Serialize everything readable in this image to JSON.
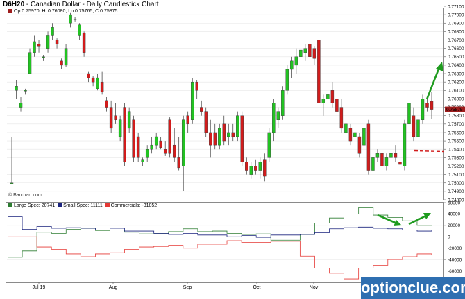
{
  "title": {
    "symbol": "D6H20",
    "text": "Canadian Dollar - Daily Candlestick Chart"
  },
  "ohlc_legend": "Op:0.75970, Hi:0.76080, Lo:0.75765, C:0.75875",
  "credit": "© Barchart.com",
  "watermark": "optionclue.com",
  "colors": {
    "up": "#22c322",
    "down": "#d11c1c",
    "large_spec": "#2e7d32",
    "small_spec": "#1a237e",
    "commercials": "#e53935",
    "last_price_bg": "#9e1d1d",
    "arrow": "#1f9b1f",
    "support": "#d11c1c"
  },
  "chart_data": [
    {
      "type": "candlestick",
      "title": "D6H20 - Canadian Dollar - Daily Candlestick Chart",
      "ylim": [
        0.748,
        0.771
      ],
      "yticks": [
        "0.77100",
        "0.77000",
        "0.76900",
        "0.76800",
        "0.76700",
        "0.76600",
        "0.76500",
        "0.76400",
        "0.76300",
        "0.76200",
        "0.76100",
        "0.76000",
        "0.75900",
        "0.75800",
        "0.75700",
        "0.75600",
        "0.75500",
        "0.75400",
        "0.75300",
        "0.75200",
        "0.75100",
        "0.75000",
        "0.74900",
        "0.74800"
      ],
      "last_price": "0.75875",
      "x_labels": [
        "Jul 19",
        "Aug",
        "Sep",
        "Oct",
        "Nov"
      ],
      "candles": [
        [
          0.75,
          0.7555,
          0.75,
          0.75
        ],
        [
          0.761,
          0.7622,
          0.76,
          0.7615
        ],
        [
          0.759,
          0.7602,
          0.7585,
          0.7595
        ],
        [
          0.761,
          0.7612,
          0.7605,
          0.761
        ],
        [
          0.763,
          0.766,
          0.763,
          0.7655
        ],
        [
          0.7655,
          0.7675,
          0.765,
          0.7668
        ],
        [
          0.7665,
          0.767,
          0.7655,
          0.7662
        ],
        [
          0.765,
          0.7652,
          0.7645,
          0.765
        ],
        [
          0.766,
          0.768,
          0.7655,
          0.7675
        ],
        [
          0.7675,
          0.769,
          0.767,
          0.7685
        ],
        [
          0.767,
          0.7672,
          0.766,
          0.7665
        ],
        [
          0.7645,
          0.7648,
          0.7635,
          0.764
        ],
        [
          0.764,
          0.7665,
          0.7638,
          0.766
        ],
        [
          0.769,
          0.7702,
          0.7685,
          0.77
        ],
        [
          0.7695,
          0.7697,
          0.7692,
          0.7695
        ],
        [
          0.7675,
          0.769,
          0.767,
          0.7688
        ],
        [
          0.7678,
          0.768,
          0.765,
          0.7655
        ],
        [
          0.763,
          0.7632,
          0.762,
          0.7625
        ],
        [
          0.7625,
          0.7627,
          0.7615,
          0.762
        ],
        [
          0.7612,
          0.763,
          0.761,
          0.7625
        ],
        [
          0.762,
          0.7632,
          0.7605,
          0.7608
        ],
        [
          0.7598,
          0.7602,
          0.7585,
          0.759
        ],
        [
          0.759,
          0.7598,
          0.756,
          0.7565
        ],
        [
          0.758,
          0.7595,
          0.757,
          0.7575
        ],
        [
          0.7555,
          0.758,
          0.755,
          0.7575
        ],
        [
          0.759,
          0.7595,
          0.752,
          0.7525
        ],
        [
          0.7565,
          0.759,
          0.756,
          0.7585
        ],
        [
          0.7575,
          0.758,
          0.7525,
          0.753
        ],
        [
          0.7555,
          0.756,
          0.7525,
          0.753
        ],
        [
          0.7525,
          0.753,
          0.752,
          0.7528
        ],
        [
          0.753,
          0.7545,
          0.7525,
          0.754
        ],
        [
          0.754,
          0.7555,
          0.7535,
          0.7545
        ],
        [
          0.7545,
          0.756,
          0.754,
          0.7555
        ],
        [
          0.755,
          0.7555,
          0.754,
          0.7542
        ],
        [
          0.754,
          0.755,
          0.7532,
          0.7535
        ],
        [
          0.7575,
          0.7578,
          0.753,
          0.7535
        ],
        [
          0.7545,
          0.7565,
          0.7525,
          0.753
        ],
        [
          0.753,
          0.7555,
          0.7515,
          0.7518
        ],
        [
          0.752,
          0.758,
          0.749,
          0.7575
        ],
        [
          0.758,
          0.7585,
          0.756,
          0.757
        ],
        [
          0.7575,
          0.7625,
          0.757,
          0.762
        ],
        [
          0.762,
          0.7622,
          0.76,
          0.761
        ],
        [
          0.759,
          0.7598,
          0.758,
          0.7585
        ],
        [
          0.7585,
          0.759,
          0.7555,
          0.756
        ],
        [
          0.756,
          0.7575,
          0.753,
          0.7545
        ],
        [
          0.756,
          0.757,
          0.754,
          0.7545
        ],
        [
          0.7545,
          0.757,
          0.754,
          0.7565
        ],
        [
          0.757,
          0.758,
          0.7545,
          0.755
        ],
        [
          0.7555,
          0.757,
          0.7545,
          0.756
        ],
        [
          0.756,
          0.757,
          0.755,
          0.7555
        ],
        [
          0.7555,
          0.7585,
          0.755,
          0.758
        ],
        [
          0.758,
          0.7585,
          0.752,
          0.7525
        ],
        [
          0.7525,
          0.753,
          0.751,
          0.7515
        ],
        [
          0.751,
          0.7525,
          0.7505,
          0.752
        ],
        [
          0.752,
          0.7528,
          0.751,
          0.7515
        ],
        [
          0.7515,
          0.753,
          0.7505,
          0.7525
        ],
        [
          0.7528,
          0.7535,
          0.7502,
          0.7508
        ],
        [
          0.753,
          0.7565,
          0.7525,
          0.756
        ],
        [
          0.756,
          0.76,
          0.755,
          0.7595
        ],
        [
          0.7575,
          0.759,
          0.7565,
          0.7585
        ],
        [
          0.758,
          0.7615,
          0.7575,
          0.761
        ],
        [
          0.761,
          0.764,
          0.7605,
          0.7635
        ],
        [
          0.7635,
          0.765,
          0.7625,
          0.7645
        ],
        [
          0.764,
          0.766,
          0.763,
          0.765
        ],
        [
          0.765,
          0.766,
          0.764,
          0.7658
        ],
        [
          0.7655,
          0.7665,
          0.7645,
          0.766
        ],
        [
          0.7665,
          0.767,
          0.7645,
          0.765
        ],
        [
          0.766,
          0.7662,
          0.764,
          0.7648
        ],
        [
          0.767,
          0.7672,
          0.759,
          0.7595
        ],
        [
          0.7595,
          0.7605,
          0.758,
          0.76
        ],
        [
          0.76,
          0.7615,
          0.7595,
          0.7605
        ],
        [
          0.761,
          0.762,
          0.759,
          0.7595
        ],
        [
          0.76,
          0.7605,
          0.758,
          0.7585
        ],
        [
          0.759,
          0.76,
          0.756,
          0.7565
        ],
        [
          0.756,
          0.7575,
          0.755,
          0.757
        ],
        [
          0.7565,
          0.757,
          0.7545,
          0.755
        ],
        [
          0.7555,
          0.7565,
          0.7545,
          0.756
        ],
        [
          0.7555,
          0.756,
          0.753,
          0.7535
        ],
        [
          0.7545,
          0.757,
          0.754,
          0.7565
        ],
        [
          0.757,
          0.7575,
          0.751,
          0.7515
        ],
        [
          0.7515,
          0.754,
          0.751,
          0.753
        ],
        [
          0.753,
          0.754,
          0.7525,
          0.7535
        ],
        [
          0.7535,
          0.7538,
          0.7515,
          0.752
        ],
        [
          0.752,
          0.7535,
          0.7515,
          0.753
        ],
        [
          0.753,
          0.754,
          0.7525,
          0.7535
        ],
        [
          0.7535,
          0.7545,
          0.7525,
          0.753
        ],
        [
          0.7525,
          0.753,
          0.7515,
          0.7522
        ],
        [
          0.752,
          0.7575,
          0.7515,
          0.757
        ],
        [
          0.757,
          0.76,
          0.7565,
          0.7595
        ],
        [
          0.758,
          0.759,
          0.755,
          0.7555
        ],
        [
          0.7555,
          0.758,
          0.755,
          0.7575
        ],
        [
          0.7575,
          0.7605,
          0.757,
          0.76
        ],
        [
          0.7595,
          0.76,
          0.7585,
          0.759
        ],
        [
          0.7597,
          0.7608,
          0.7576,
          0.75875
        ]
      ]
    },
    {
      "type": "line",
      "title": "COT",
      "ylim": [
        -80000,
        60000
      ],
      "yticks": [
        "60000",
        "40000",
        "20000",
        "0",
        "-20000",
        "-40000",
        "-60000"
      ],
      "series": [
        {
          "name": "Large Spec: 20741",
          "values": [
            -36000,
            -25000,
            8000,
            6000,
            13000,
            15000,
            11000,
            12000,
            8000,
            5000,
            5000,
            9000,
            14000,
            9000,
            10000,
            6000,
            4000,
            5000,
            -6000,
            -6000,
            4000,
            24000,
            33000,
            40000,
            51000,
            38000,
            34000,
            28000,
            20000,
            20741
          ]
        },
        {
          "name": "Small Spec: 11111",
          "values": [
            35000,
            13000,
            18000,
            15000,
            16000,
            15000,
            12000,
            15000,
            10000,
            10000,
            6000,
            4000,
            6000,
            3000,
            3000,
            0,
            2000,
            -1000,
            3000,
            3000,
            4000,
            7000,
            14000,
            16000,
            17000,
            15000,
            14000,
            12000,
            10000,
            11111
          ]
        },
        {
          "name": "Commercials: -31852",
          "values": [
            0,
            0,
            -18000,
            -22000,
            -30000,
            -35000,
            -30000,
            -28000,
            -22000,
            -18000,
            -17000,
            -15000,
            -20000,
            -13000,
            -13000,
            -7000,
            -10000,
            -10000,
            -8000,
            -8000,
            -34000,
            -55000,
            -64000,
            -74000,
            -55000,
            -50000,
            -40000,
            -35000,
            -30000,
            -31852
          ]
        }
      ]
    }
  ]
}
